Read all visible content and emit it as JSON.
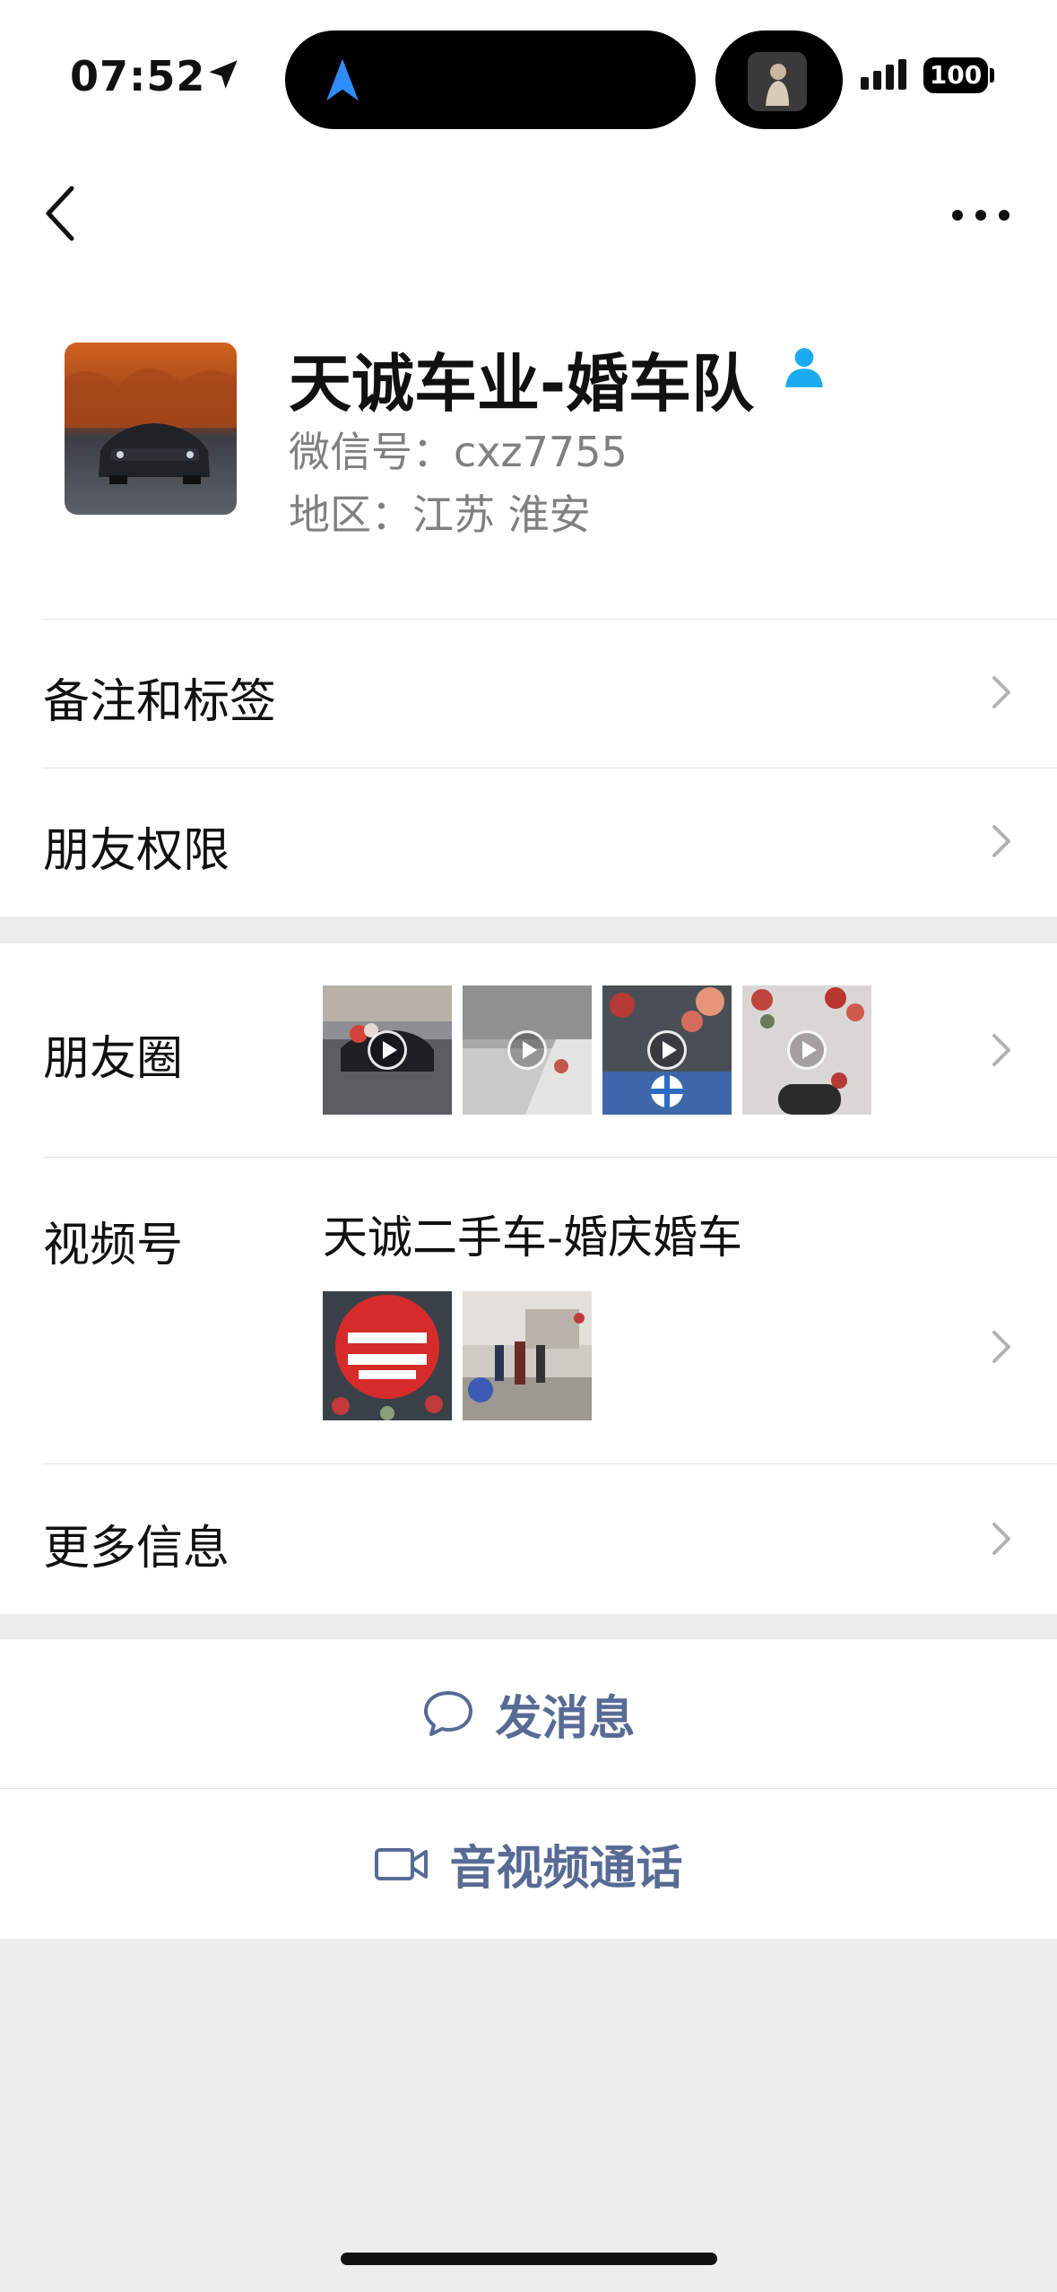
{
  "status_bar": {
    "time": "07:52",
    "battery": "100"
  },
  "profile": {
    "name": "天诚车业-婚车队",
    "wechat_id": "微信号：cxz7755",
    "region": "地区：江苏 淮安"
  },
  "rows": {
    "notes_tags": "备注和标签",
    "friend_permissions": "朋友权限",
    "moments": "朋友圈",
    "channels": "视频号",
    "channel_name": "天诚二手车-婚庆婚车",
    "more_info": "更多信息"
  },
  "actions": {
    "send_message": "发消息",
    "video_call": "音视频通话"
  },
  "colors": {
    "link_blue": "#576b95",
    "verified_icon": "#1aabf0",
    "background": "#ededed"
  },
  "icons": [
    "location-arrow-icon",
    "navigation-icon",
    "signal-icon",
    "battery-icon",
    "back-icon",
    "more-icon",
    "verified-person-icon",
    "chevron-right-icon",
    "play-icon",
    "chat-bubble-icon",
    "video-camera-icon"
  ]
}
